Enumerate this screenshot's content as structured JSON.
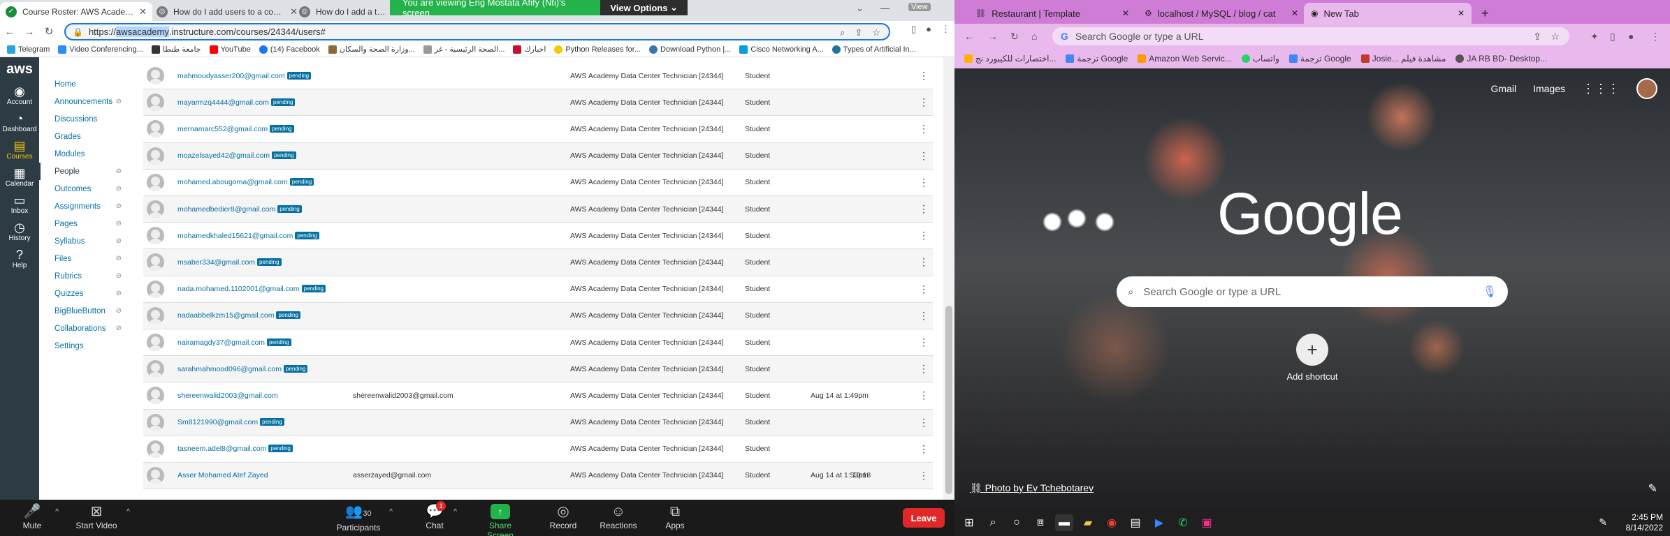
{
  "left_browser": {
    "tabs": [
      {
        "label": "Course Roster: AWS Academy Da",
        "active": true
      },
      {
        "label": "How do I add users to a course?",
        "active": false
      },
      {
        "label": "How do I add a text (SMS",
        "active": false
      }
    ],
    "share_banner": {
      "text": "You are viewing Eng Mostata Afify (Nti)'s screen",
      "button": "View Options"
    },
    "view_label": "View",
    "url": {
      "prefix": "https://",
      "highlight": "awsacademy",
      "rest": ".instructure.com/courses/24344/users#"
    },
    "bookmarks": [
      "Telegram",
      "Video Conferencing...",
      "جامعة طنطا",
      "YouTube",
      "(14) Facebook",
      "وزارة الصحة والسكان...",
      "الصحة الرئيسية - غر...",
      "اخبارك",
      "Python Releases for...",
      "Download Python |...",
      "Cisco Networking A...",
      "Types of Artificial In..."
    ]
  },
  "canvas": {
    "logo": "aws",
    "global_nav": [
      {
        "label": "Account",
        "icon": "account-icon"
      },
      {
        "label": "Dashboard",
        "icon": "dashboard-icon"
      },
      {
        "label": "Courses",
        "icon": "courses-icon"
      },
      {
        "label": "Calendar",
        "icon": "calendar-icon"
      },
      {
        "label": "Inbox",
        "icon": "inbox-icon"
      },
      {
        "label": "History",
        "icon": "history-icon"
      },
      {
        "label": "Help",
        "icon": "help-icon"
      }
    ],
    "course_nav": [
      {
        "label": "Home",
        "hidden": false,
        "active": false
      },
      {
        "label": "Announcements",
        "hidden": true,
        "active": false
      },
      {
        "label": "Discussions",
        "hidden": false,
        "active": false
      },
      {
        "label": "Grades",
        "hidden": false,
        "active": false
      },
      {
        "label": "Modules",
        "hidden": false,
        "active": false
      },
      {
        "label": "People",
        "hidden": true,
        "active": true
      },
      {
        "label": "Outcomes",
        "hidden": true,
        "active": false
      },
      {
        "label": "Assignments",
        "hidden": true,
        "active": false
      },
      {
        "label": "Pages",
        "hidden": true,
        "active": false
      },
      {
        "label": "Syllabus",
        "hidden": true,
        "active": false
      },
      {
        "label": "Files",
        "hidden": true,
        "active": false
      },
      {
        "label": "Rubrics",
        "hidden": true,
        "active": false
      },
      {
        "label": "Quizzes",
        "hidden": true,
        "active": false
      },
      {
        "label": "BigBlueButton",
        "hidden": true,
        "active": false
      },
      {
        "label": "Collaborations",
        "hidden": true,
        "active": false
      },
      {
        "label": "Settings",
        "hidden": false,
        "active": false
      }
    ],
    "pending_label": "pending",
    "roster": [
      {
        "name": "mahmoudyasser200@gmail.com",
        "pending": true,
        "login": "",
        "section": "AWS Academy Data Center Technician [24344]",
        "role": "Student",
        "last_activity": "",
        "total_activity": ""
      },
      {
        "name": "mayarmzq4444@gmail.com",
        "pending": true,
        "login": "",
        "section": "AWS Academy Data Center Technician [24344]",
        "role": "Student",
        "last_activity": "",
        "total_activity": ""
      },
      {
        "name": "mernamarc552@gmail.com",
        "pending": true,
        "login": "",
        "section": "AWS Academy Data Center Technician [24344]",
        "role": "Student",
        "last_activity": "",
        "total_activity": ""
      },
      {
        "name": "moazelsayed42@gmail.com",
        "pending": true,
        "login": "",
        "section": "AWS Academy Data Center Technician [24344]",
        "role": "Student",
        "last_activity": "",
        "total_activity": ""
      },
      {
        "name": "mohamed.abougoma@gmail.com",
        "pending": true,
        "login": "",
        "section": "AWS Academy Data Center Technician [24344]",
        "role": "Student",
        "last_activity": "",
        "total_activity": ""
      },
      {
        "name": "mohamedbedier8@gmail.com",
        "pending": true,
        "login": "",
        "section": "AWS Academy Data Center Technician [24344]",
        "role": "Student",
        "last_activity": "",
        "total_activity": ""
      },
      {
        "name": "mohamedkhaled15621@gmail.com",
        "pending": true,
        "login": "",
        "section": "AWS Academy Data Center Technician [24344]",
        "role": "Student",
        "last_activity": "",
        "total_activity": ""
      },
      {
        "name": "msaber334@gmail.com",
        "pending": true,
        "login": "",
        "section": "AWS Academy Data Center Technician [24344]",
        "role": "Student",
        "last_activity": "",
        "total_activity": ""
      },
      {
        "name": "nada.mohamed.1102001@gmail.com",
        "pending": true,
        "login": "",
        "section": "AWS Academy Data Center Technician [24344]",
        "role": "Student",
        "last_activity": "",
        "total_activity": ""
      },
      {
        "name": "nadaabbelkzm15@gmail.com",
        "pending": true,
        "login": "",
        "section": "AWS Academy Data Center Technician [24344]",
        "role": "Student",
        "last_activity": "",
        "total_activity": ""
      },
      {
        "name": "nairamagdy37@gmail.com",
        "pending": true,
        "login": "",
        "section": "AWS Academy Data Center Technician [24344]",
        "role": "Student",
        "last_activity": "",
        "total_activity": ""
      },
      {
        "name": "sarahmahmood096@gmail.com",
        "pending": true,
        "login": "",
        "section": "AWS Academy Data Center Technician [24344]",
        "role": "Student",
        "last_activity": "",
        "total_activity": ""
      },
      {
        "name": "shereenwalid2003@gmail.com",
        "pending": false,
        "login": "shereenwalid2003@gmail.com",
        "section": "AWS Academy Data Center Technician [24344]",
        "role": "Student",
        "last_activity": "Aug 14 at 1:49pm",
        "total_activity": ""
      },
      {
        "name": "Sm8121990@gmail.com",
        "pending": true,
        "login": "",
        "section": "AWS Academy Data Center Technician [24344]",
        "role": "Student",
        "last_activity": "",
        "total_activity": ""
      },
      {
        "name": "tasneem.adel8@gmail.com",
        "pending": true,
        "login": "",
        "section": "AWS Academy Data Center Technician [24344]",
        "role": "Student",
        "last_activity": "",
        "total_activity": ""
      },
      {
        "name": "Asser Mohamed Atef Zayed",
        "pending": false,
        "login": "asserzayed@gmail.com",
        "section": "AWS Academy Data Center Technician [24344]",
        "role": "Student",
        "last_activity": "Aug 14 at 1:53pm",
        "total_activity": "10:18"
      }
    ]
  },
  "right_browser": {
    "tabs": [
      {
        "label": "Restaurant | Template",
        "active": false
      },
      {
        "label": "localhost / MySQL / blog / cat",
        "active": false
      },
      {
        "label": "New Tab",
        "active": true
      }
    ],
    "address_placeholder": "Search Google or type a URL",
    "bookmarks": [
      "اختصارات للكيبورد نج...",
      "ترجمة Google",
      "Amazon Web Servic...",
      "واتساب",
      "ترجمة Google",
      "Josie... مشاهدة فيلم",
      "JA RB  BD- Desktop..."
    ],
    "google": {
      "gmail": "Gmail",
      "images": "Images",
      "logo": "Google",
      "search_placeholder": "Search Google or type a URL",
      "add_shortcut": "Add shortcut",
      "photo_credit": "Photo by Ev Tchebotarev"
    }
  },
  "zoom": {
    "mute": "Mute",
    "stop_video": "Start Video",
    "participants": "Participants",
    "participants_count": "30",
    "chat": "Chat",
    "chat_badge": "1",
    "share_screen": "Share Screen",
    "record": "Record",
    "reactions": "Reactions",
    "apps": "Apps",
    "leave": "Leave"
  },
  "taskbar": {
    "time": "2:45 PM",
    "date": "8/14/2022"
  },
  "colors": {
    "canvas_nav": "#2d3b45",
    "link": "#0770a3",
    "share_green": "#23b34a",
    "leave_red": "#e02828",
    "right_theme": "#cf7cd6"
  }
}
